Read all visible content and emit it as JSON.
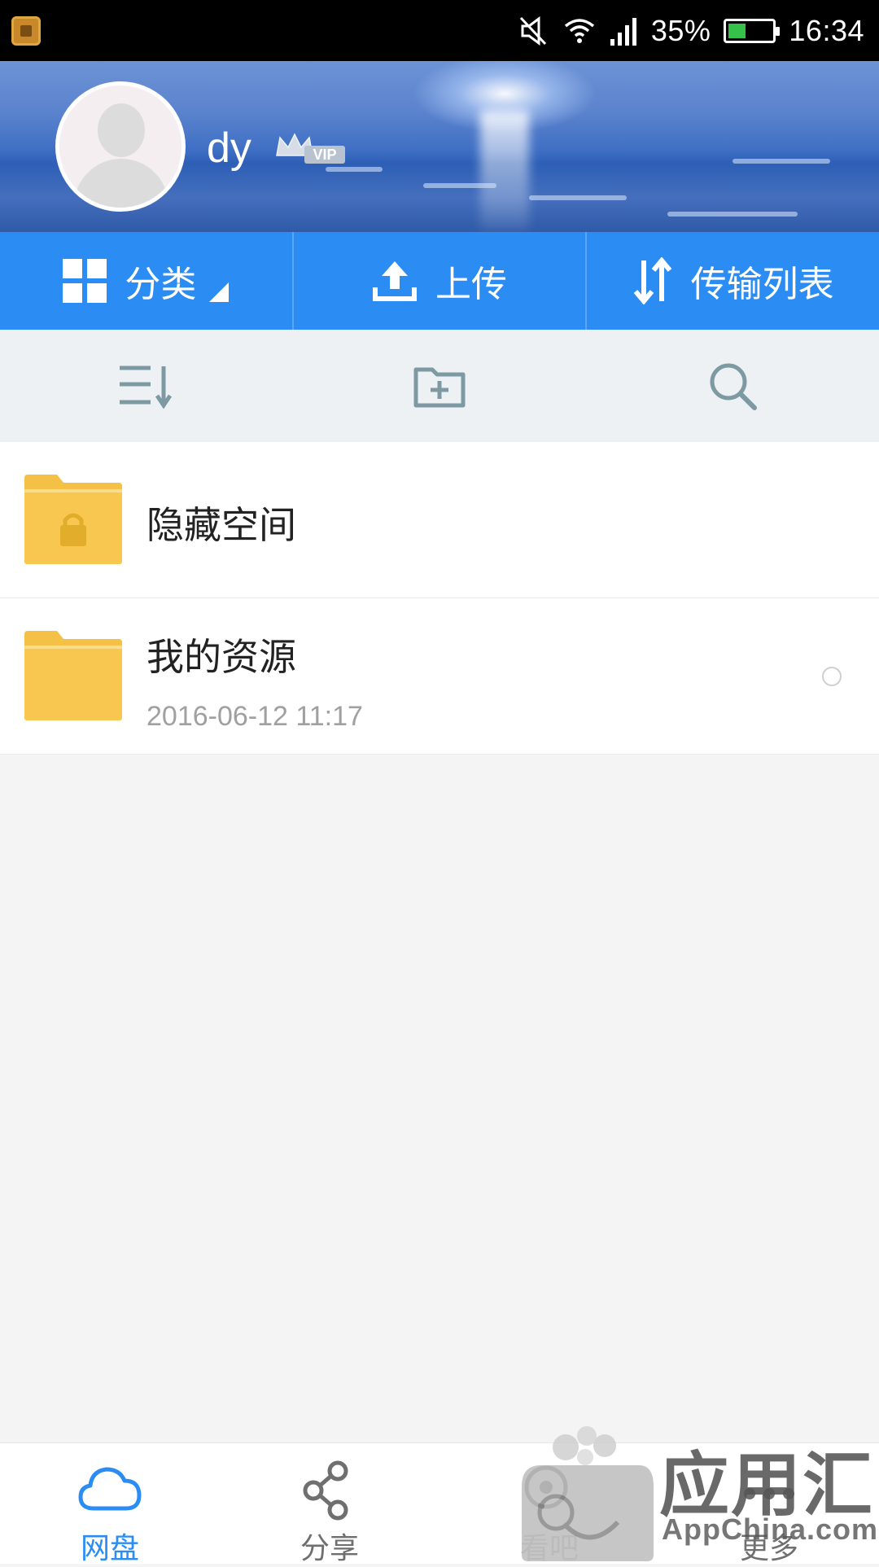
{
  "status_bar": {
    "battery_percent": "35%",
    "time": "16:34",
    "icons": [
      "app-notification-icon",
      "mute-icon",
      "wifi-icon",
      "signal-icon",
      "battery-icon"
    ]
  },
  "profile": {
    "username": "dy",
    "badge": "VIP"
  },
  "actions": [
    {
      "label": "分类",
      "icon": "grid-icon"
    },
    {
      "label": "上传",
      "icon": "upload-icon"
    },
    {
      "label": "传输列表",
      "icon": "transfer-icon"
    }
  ],
  "toolbar": {
    "icons": [
      "sort-icon",
      "new-folder-icon",
      "search-icon"
    ]
  },
  "files": [
    {
      "name": "隐藏空间",
      "date": "",
      "locked": true
    },
    {
      "name": "我的资源",
      "date": "2016-06-12  11:17",
      "locked": false
    }
  ],
  "bottom_nav": [
    {
      "label": "网盘",
      "icon": "cloud-icon",
      "active": true
    },
    {
      "label": "分享",
      "icon": "share-icon",
      "active": false
    },
    {
      "label": "看吧",
      "icon": "view-icon",
      "active": false
    },
    {
      "label": "更多",
      "icon": "more-icon",
      "active": false
    }
  ],
  "watermark": {
    "brand": "应用汇",
    "sub": "AppChina.com"
  },
  "colors": {
    "accent": "#2b8df4",
    "nav_active": "#2b8df4",
    "nav_inactive": "#6f6f6f",
    "folder": "#f5c046",
    "toolbar_icon": "#7d9aa3"
  }
}
